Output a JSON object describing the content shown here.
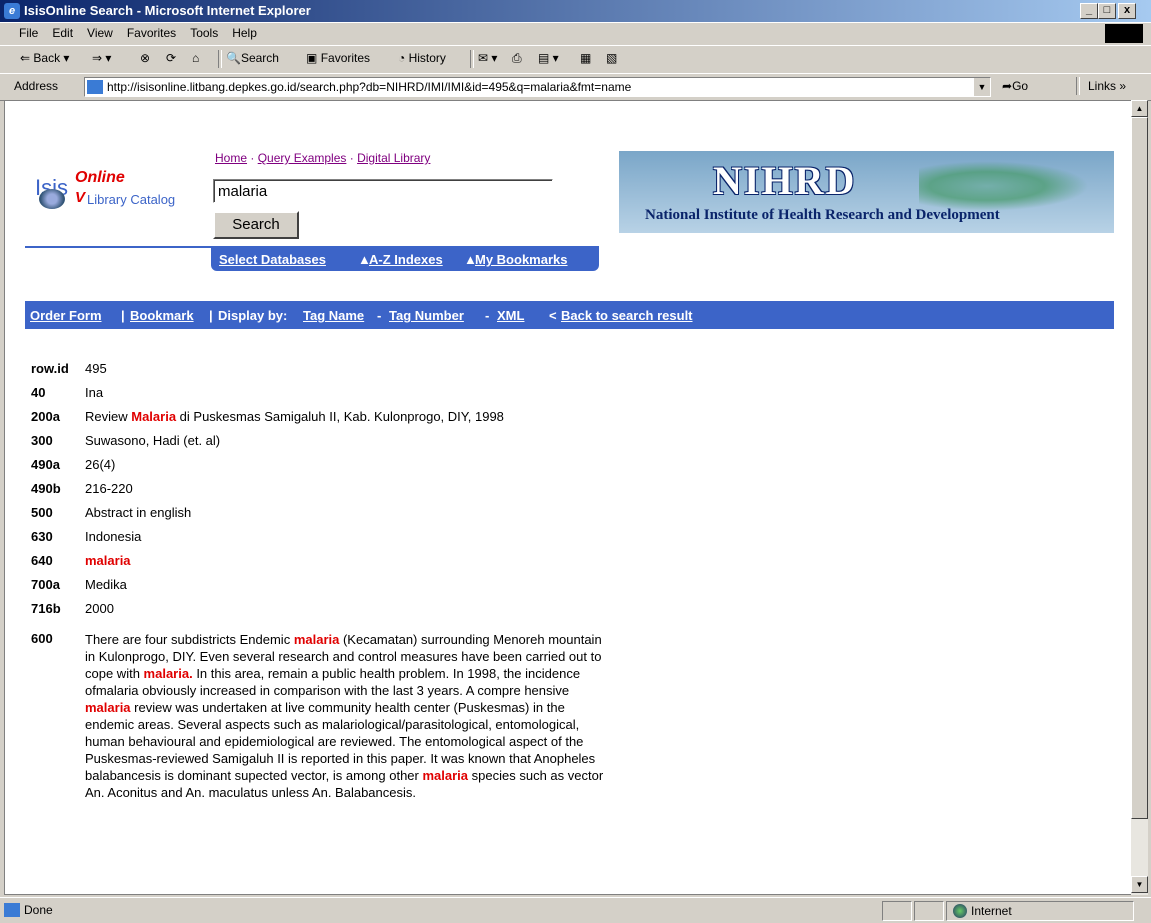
{
  "window": {
    "title": "IsisOnline Search - Microsoft Internet Explorer",
    "min": "_",
    "max": "□",
    "close": "x"
  },
  "menu": {
    "items": [
      "File",
      "Edit",
      "View",
      "Favorites",
      "Tools",
      "Help"
    ]
  },
  "toolbar": {
    "back": "Back",
    "search": "Search",
    "favorites": "Favorites",
    "history": "History"
  },
  "address": {
    "label": "Address",
    "url": "http://isisonline.litbang.depkes.go.id/search.php?db=NIHRD/IMI/IMI&id=495&q=malaria&fmt=name",
    "go": "Go",
    "links": "Links"
  },
  "header": {
    "top_links": [
      "Home",
      "Query Examples",
      "Digital Library"
    ],
    "logo": {
      "isis": "Isis",
      "online": "Online",
      "catalog": "Library Catalog"
    },
    "search_value": "malaria",
    "search_button": "Search",
    "banner": {
      "title": "NIHRD",
      "subtitle": "National Institute of Health Research and Development"
    },
    "tabs": [
      "Select Databases",
      "A-Z Indexes",
      "My Bookmarks"
    ]
  },
  "navbar": {
    "order_form": "Order Form",
    "bookmark": "Bookmark",
    "display_by": "Display by:",
    "tag_name": "Tag Name",
    "tag_number": "Tag Number",
    "xml": "XML",
    "back": "Back to search result"
  },
  "record": {
    "rowid": {
      "tag": "row.id",
      "val": "495"
    },
    "f40": {
      "tag": "40",
      "val": "Ina"
    },
    "f200a": {
      "tag": "200a",
      "pre": "Review ",
      "hl": "Malaria",
      "post": " di Puskesmas Samigaluh II, Kab. Kulonprogo, DIY, 1998"
    },
    "f300": {
      "tag": "300",
      "val": "Suwasono, Hadi (et. al)"
    },
    "f490a": {
      "tag": "490a",
      "val": "26(4)"
    },
    "f490b": {
      "tag": "490b",
      "val": "216-220"
    },
    "f500": {
      "tag": "500",
      "val": "Abstract in english"
    },
    "f630": {
      "tag": "630",
      "val": "Indonesia"
    },
    "f640": {
      "tag": "640",
      "val": "malaria"
    },
    "f700a": {
      "tag": "700a",
      "val": "Medika"
    },
    "f716b": {
      "tag": "716b",
      "val": "2000"
    },
    "f600": {
      "tag": "600",
      "p1": "There are four subdistricts Endemic ",
      "h1": "malaria",
      "p2": " (Kecamatan) surrounding Menoreh mountain in Kulonprogo, DIY. Even several research and control measures have been carried out to cope with ",
      "h2": "malaria.",
      "p3": " In this area, remain a public health problem. In 1998, the incidence ofmalaria obviously increased in comparison with the last 3 years. A compre hensive ",
      "h3": "malaria",
      "p4": " review was undertaken at live community health center (Puskesmas) in the endemic areas. Several aspects such as malariological/parasitological, entomological, human behavioural and epidemiological are reviewed. The entomological aspect of the Puskesmas-reviewed Samigaluh II is reported in this paper. It was known that Anopheles balabancesis is dominant supected vector, is among other ",
      "h4": "malaria",
      "p5": " species such as vector An. Aconitus and An. maculatus unless An. Balabancesis."
    }
  },
  "status": {
    "text": "Done",
    "zone": "Internet"
  }
}
